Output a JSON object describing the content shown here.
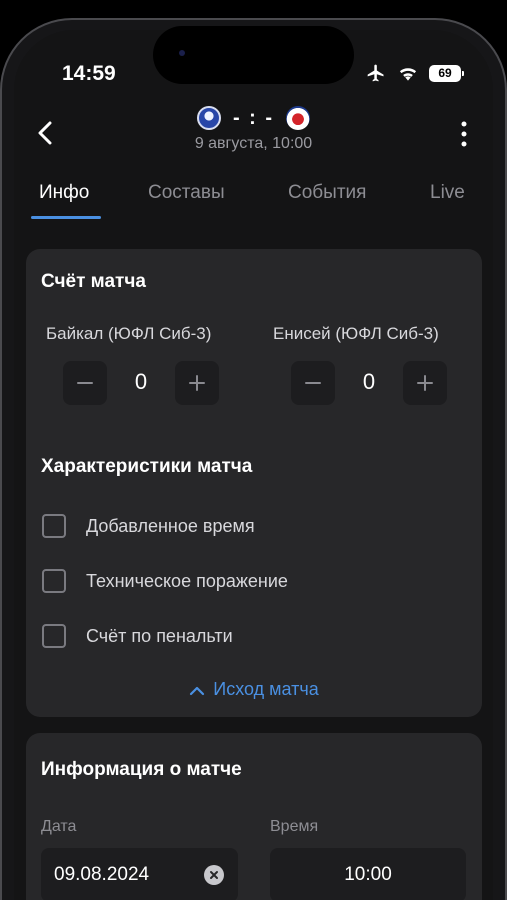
{
  "status_bar": {
    "time": "14:59",
    "battery": "69"
  },
  "header": {
    "home_team": "Байкал",
    "away_team": "Енисей",
    "score": "- : -",
    "date": "9 августа, 10:00"
  },
  "tabs": [
    {
      "label": "Инфо",
      "active": true
    },
    {
      "label": "Составы",
      "active": false
    },
    {
      "label": "События",
      "active": false
    },
    {
      "label": "Live",
      "active": false
    }
  ],
  "score_card": {
    "title": "Счёт матча",
    "home": {
      "name": "Байкал (ЮФЛ Сиб-3)",
      "score": "0"
    },
    "away": {
      "name": "Енисей (ЮФЛ Сиб-3)",
      "score": "0"
    },
    "characteristics_title": "Характеристики матча",
    "checkboxes": [
      {
        "label": "Добавленное время",
        "checked": false
      },
      {
        "label": "Техническое поражение",
        "checked": false
      },
      {
        "label": "Счёт по пенальти",
        "checked": false
      }
    ],
    "outcome_link": "Исход матча"
  },
  "info_card": {
    "title": "Информация о матче",
    "date_label": "Дата",
    "date_value": "09.08.2024",
    "time_label": "Время",
    "time_value": "10:00"
  },
  "colors": {
    "accent": "#4a90e2",
    "card": "#272729",
    "background": "#141415"
  },
  "icons": [
    "back-arrow-icon",
    "more-vertical-icon",
    "airplane-icon",
    "wifi-icon",
    "battery-icon",
    "minus-icon",
    "plus-icon",
    "chevron-up-icon",
    "clear-icon"
  ]
}
